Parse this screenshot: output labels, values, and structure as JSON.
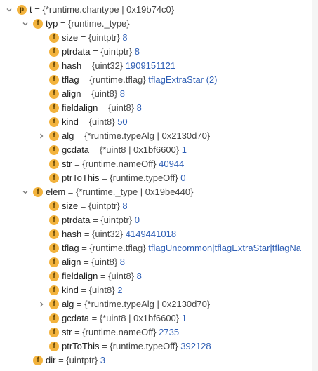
{
  "rows": [
    {
      "indent": 0,
      "arrow": "down",
      "badge": "p",
      "name": "t",
      "type": "{*runtime.chantype | 0x19b74c0}",
      "value": ""
    },
    {
      "indent": 1,
      "arrow": "down",
      "badge": "f",
      "name": "typ",
      "type": "{runtime._type}",
      "value": ""
    },
    {
      "indent": 2,
      "arrow": "",
      "badge": "f",
      "name": "size",
      "type": "{uintptr}",
      "value": "8"
    },
    {
      "indent": 2,
      "arrow": "",
      "badge": "f",
      "name": "ptrdata",
      "type": "{uintptr}",
      "value": "8"
    },
    {
      "indent": 2,
      "arrow": "",
      "badge": "f",
      "name": "hash",
      "type": "{uint32}",
      "value": "1909151121"
    },
    {
      "indent": 2,
      "arrow": "",
      "badge": "f",
      "name": "tflag",
      "type": "{runtime.tflag}",
      "value": "tflagExtraStar (2)"
    },
    {
      "indent": 2,
      "arrow": "",
      "badge": "f",
      "name": "align",
      "type": "{uint8}",
      "value": "8"
    },
    {
      "indent": 2,
      "arrow": "",
      "badge": "f",
      "name": "fieldalign",
      "type": "{uint8}",
      "value": "8"
    },
    {
      "indent": 2,
      "arrow": "",
      "badge": "f",
      "name": "kind",
      "type": "{uint8}",
      "value": "50"
    },
    {
      "indent": 2,
      "arrow": "right",
      "badge": "f",
      "name": "alg",
      "type": "{*runtime.typeAlg | 0x2130d70}",
      "value": ""
    },
    {
      "indent": 2,
      "arrow": "",
      "badge": "f",
      "name": "gcdata",
      "type": "{*uint8 | 0x1bf6600}",
      "value": "1"
    },
    {
      "indent": 2,
      "arrow": "",
      "badge": "f",
      "name": "str",
      "type": "{runtime.nameOff}",
      "value": "40944"
    },
    {
      "indent": 2,
      "arrow": "",
      "badge": "f",
      "name": "ptrToThis",
      "type": "{runtime.typeOff}",
      "value": "0"
    },
    {
      "indent": 1,
      "arrow": "down",
      "badge": "f",
      "name": "elem",
      "type": "{*runtime._type | 0x19be440}",
      "value": ""
    },
    {
      "indent": 2,
      "arrow": "",
      "badge": "f",
      "name": "size",
      "type": "{uintptr}",
      "value": "8"
    },
    {
      "indent": 2,
      "arrow": "",
      "badge": "f",
      "name": "ptrdata",
      "type": "{uintptr}",
      "value": "0"
    },
    {
      "indent": 2,
      "arrow": "",
      "badge": "f",
      "name": "hash",
      "type": "{uint32}",
      "value": "4149441018"
    },
    {
      "indent": 2,
      "arrow": "",
      "badge": "f",
      "name": "tflag",
      "type": "{runtime.tflag}",
      "value": "tflagUncommon|tflagExtraStar|tflagNa"
    },
    {
      "indent": 2,
      "arrow": "",
      "badge": "f",
      "name": "align",
      "type": "{uint8}",
      "value": "8"
    },
    {
      "indent": 2,
      "arrow": "",
      "badge": "f",
      "name": "fieldalign",
      "type": "{uint8}",
      "value": "8"
    },
    {
      "indent": 2,
      "arrow": "",
      "badge": "f",
      "name": "kind",
      "type": "{uint8}",
      "value": "2"
    },
    {
      "indent": 2,
      "arrow": "right",
      "badge": "f",
      "name": "alg",
      "type": "{*runtime.typeAlg | 0x2130d70}",
      "value": ""
    },
    {
      "indent": 2,
      "arrow": "",
      "badge": "f",
      "name": "gcdata",
      "type": "{*uint8 | 0x1bf6600}",
      "value": "1"
    },
    {
      "indent": 2,
      "arrow": "",
      "badge": "f",
      "name": "str",
      "type": "{runtime.nameOff}",
      "value": "2735"
    },
    {
      "indent": 2,
      "arrow": "",
      "badge": "f",
      "name": "ptrToThis",
      "type": "{runtime.typeOff}",
      "value": "392128"
    },
    {
      "indent": 1,
      "arrow": "",
      "badge": "f",
      "name": "dir",
      "type": "{uintptr}",
      "value": "3"
    }
  ]
}
